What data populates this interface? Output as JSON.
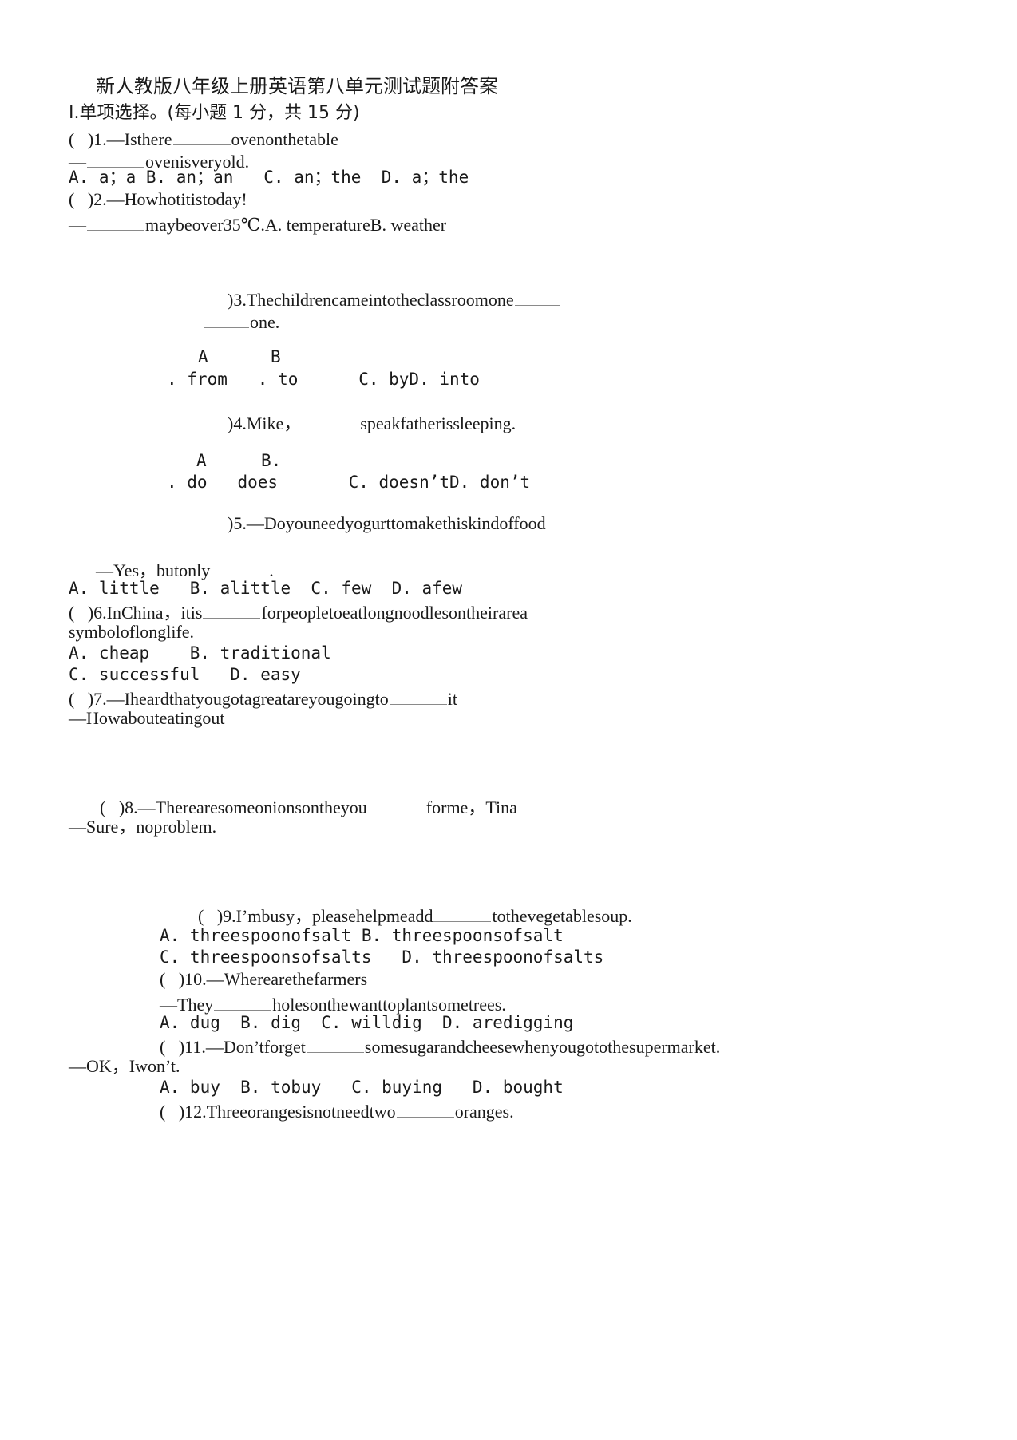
{
  "document": {
    "title": "新人教版八年级上册英语第八单元测试题附答案",
    "section_heading": "Ⅰ.单项选择。(每小题 1 分，共 15 分)"
  },
  "lines": {
    "q1_stem_a": "(   )1.—Isthere",
    "q1_stem_a_tail": "ovenonthetable",
    "q1_stem_b": "—",
    "q1_stem_b_tail": "ovenisveryold.",
    "q1_options": "A. a；a B. an；an   C. an；the  D. a；the",
    "q2_stem_a": "(   )2.—Howhotitistoday!",
    "q2_stem_b": "—",
    "q2_stem_b_tail": "maybeover35℃.A. temperatureB. weather",
    "q3_stem": ")3.Thechildrencameintotheclassroomone",
    "q3_stem_cont": "one.",
    "q3_opt_letters_a": "A",
    "q3_opt_letters_b": "B",
    "q3_options": ". from   . to      C. byD. into",
    "q4_stem": ")4.Mike，",
    "q4_stem_tail": "speakfatherissleeping.",
    "q4_opt_letters_a": "A",
    "q4_opt_letters_b": "B.",
    "q4_options": ". do   does       C. doesn’tD. don’t",
    "q5_stem": ")5.—Doyouneedyogurttomakethiskindoffood",
    "q5_reply": "—Yes，butonly",
    "q5_reply_tail": ".",
    "q5_options": "A. little   B. alittle  C. few  D. afew",
    "q6_stem": "(   )6.InChina，itis",
    "q6_stem_tail": "forpeopletoeatlongnoodlesontheirarea",
    "q6_stem_cont": "symboloflonglife.",
    "q6_options_ab": "A. cheap    B. traditional",
    "q6_options_cd": "C. successful   D. easy",
    "q7_stem": "(   )7.—Iheardthatyougotagreatareyougoingto",
    "q7_stem_tail": "it",
    "q7_reply": "—Howabouteatingout",
    "q8_stem": "(   )8.—Therearesomeonionsontheyou",
    "q8_stem_tail": "forme，Tina",
    "q8_reply": "—Sure，noproblem.",
    "q9_stem": "(   )9.I’mbusy，pleasehelpmeadd",
    "q9_stem_tail": "tothevegetablesoup.",
    "q9_options_ab": "A. threespoonofsalt B. threespoonsofsalt",
    "q9_options_cd": "C. threespoonsofsalts   D. threespoonofsalts",
    "q10_stem": "(   )10.—Wherearethefarmers",
    "q10_reply": "—They",
    "q10_reply_tail": "holesonthewanttoplantsometrees.",
    "q10_options": "A. dug  B. dig  C. willdig  D. aredigging",
    "q11_stem": "(   )11.—Don’tforget",
    "q11_stem_tail": "somesugarandcheesewhenyougotothesupermarket.",
    "q11_reply": "—OK，Iwon’t.",
    "q11_options": "A. buy  B. tobuy   C. buying   D. bought",
    "q12_stem": "(   )12.Threeorangesisnotneedtwo",
    "q12_stem_tail": "oranges."
  }
}
